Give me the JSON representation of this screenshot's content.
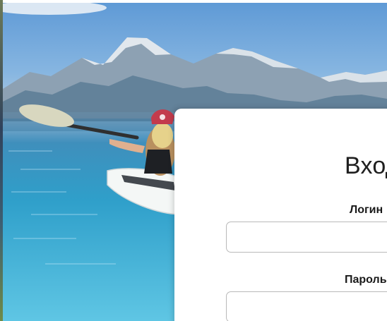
{
  "form": {
    "title": "Вход",
    "login_label": "Логин",
    "login_value": "",
    "password_label": "Пароль",
    "password_value": ""
  },
  "background": {
    "scene": "mountain-lake-kayak",
    "sky_color": "#6da4d8",
    "water_color": "#2f9fca"
  }
}
